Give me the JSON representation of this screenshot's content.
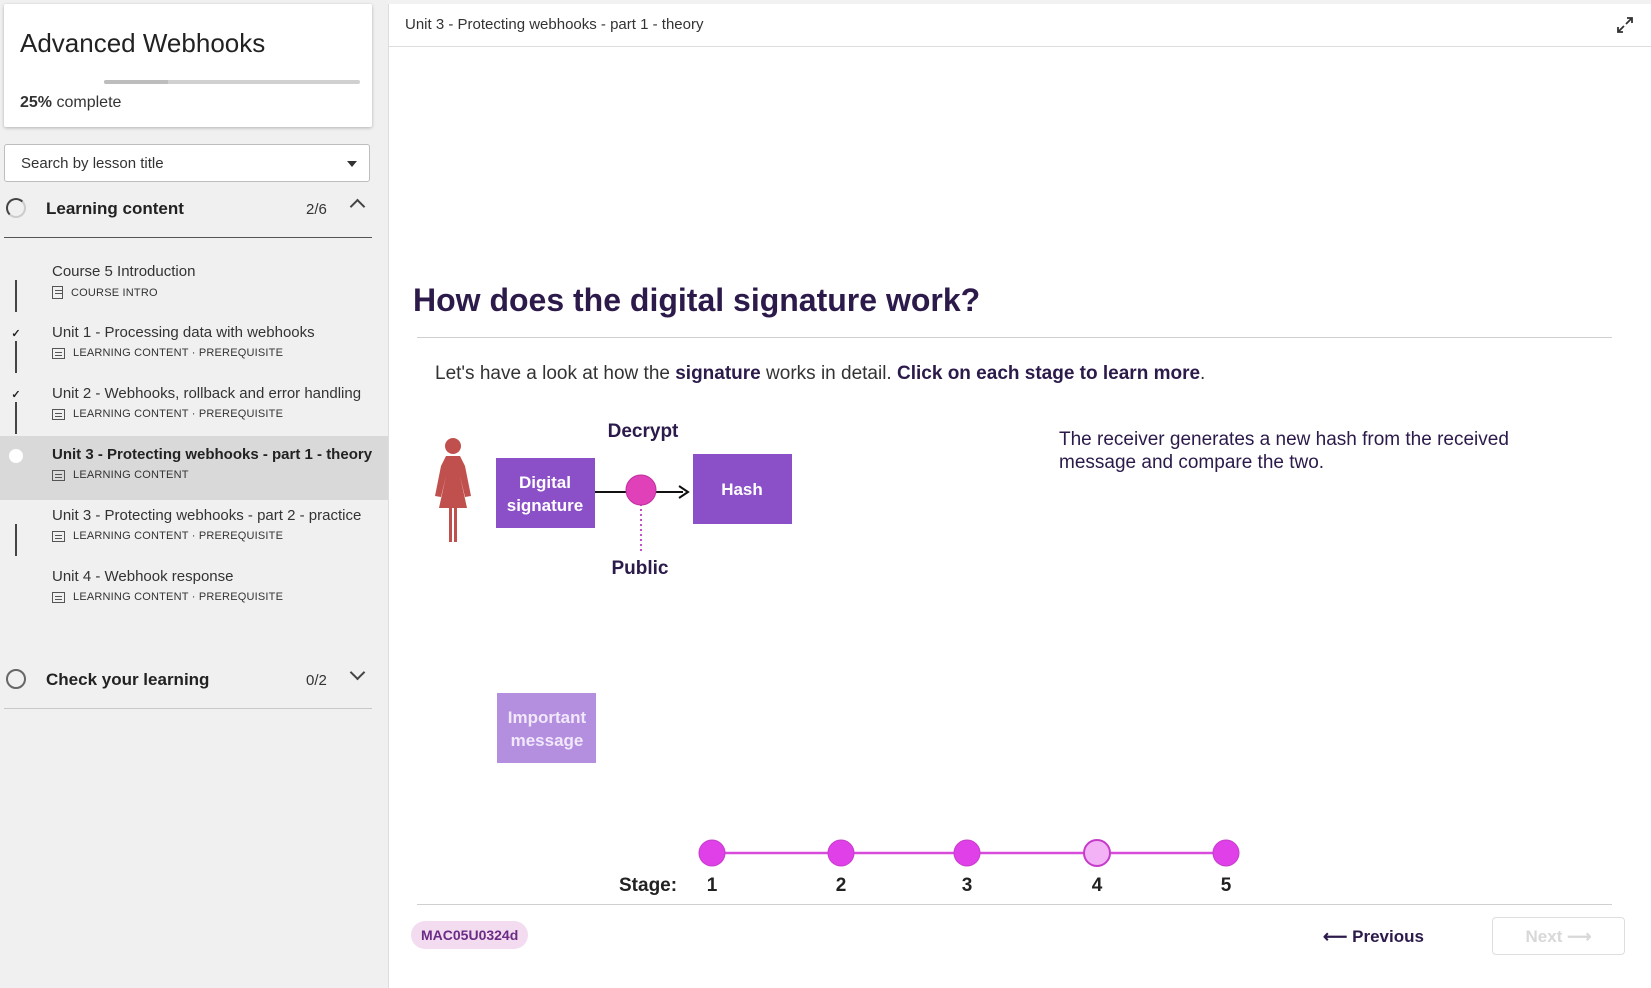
{
  "sidebar": {
    "course_title": "Advanced Webhooks",
    "progress_percent": "25%",
    "progress_suffix": "complete",
    "progress_fraction": 0.25,
    "search_placeholder": "Search by lesson title",
    "sections": [
      {
        "label": "Learning content",
        "count": "2/6",
        "expanded": true,
        "lessons": [
          {
            "title": "Course 5 Introduction",
            "meta": "COURSE INTRO",
            "completed": false,
            "active": false
          },
          {
            "title": "Unit 1 - Processing data with webhooks",
            "meta": "LEARNING CONTENT · PREREQUISITE",
            "completed": true,
            "active": false
          },
          {
            "title": "Unit 2 - Webhooks, rollback and error handling",
            "meta": "LEARNING CONTENT · PREREQUISITE",
            "completed": true,
            "active": false
          },
          {
            "title": "Unit 3 - Protecting webhooks - part 1 - theory",
            "meta": "LEARNING CONTENT",
            "completed": false,
            "active": true
          },
          {
            "title": "Unit 3 - Protecting webhooks - part 2 - practice",
            "meta": "LEARNING CONTENT · PREREQUISITE",
            "completed": false,
            "active": false
          },
          {
            "title": "Unit 4 - Webhook response",
            "meta": "LEARNING CONTENT · PREREQUISITE",
            "completed": false,
            "active": false
          }
        ]
      },
      {
        "label": "Check your learning",
        "count": "0/2",
        "expanded": false
      }
    ]
  },
  "main": {
    "topbar_title": "Unit 3 - Protecting webhooks - part 1 - theory",
    "heading": "How does the digital signature work?",
    "intro_1": "Let's have a look at how the ",
    "intro_bold_1": "signature",
    "intro_2": " works in detail. ",
    "intro_bold_2": "Click on each stage to learn more",
    "intro_3": ".",
    "diagram": {
      "decrypt": "Decrypt",
      "box_signature": [
        "Digital",
        "signature"
      ],
      "box_hash": "Hash",
      "public": "Public",
      "box_message": [
        "Important",
        "message"
      ]
    },
    "description": "The receiver generates a new hash from the received message and compare the two.",
    "stages": {
      "label": "Stage:",
      "items": [
        "1",
        "2",
        "3",
        "4",
        "5"
      ],
      "current": 4
    },
    "badge": "MAC05U0324d",
    "previous_label": "Previous",
    "next_label": "Next"
  },
  "colors": {
    "accent_purple": "#8b4fc7",
    "magenta": "#e040e8",
    "magenta_light": "#f2b2f5",
    "heading": "#2b1a4a",
    "person": "#c0504d"
  }
}
